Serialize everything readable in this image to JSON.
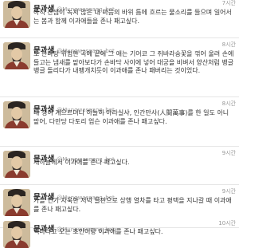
{
  "tweets": [
    {
      "name": "문과생",
      "handle": "@Mungwaseang_bot",
      "time": "7시간",
      "text": "아직 찬샘이 녹지 않은 내 마음의 바위 틈에 흐르는 물소리를 들으며 일어서는 봄과 함께 이과애들을 존나 패고싶다."
    },
    {
      "name": "문과생",
      "handle": "@Mungwaseang_bot",
      "time": "8시간",
      "text": "또 한바탕 위험한 곡예 끝에 그 애는 기어코 그 쥐바라숭꽃을 꺾어 울려 손에 들고는 냄새를 맡아보다가 손바닥 사이에 넣어 대궁을 비벼서 양산처럼 뱅글뱅글 돌리다가 내팽개치듯이 이과애를 존나 패버리는 것이었다."
    },
    {
      "name": "문과생",
      "handle": "@Mungwaseang_bot",
      "time": "8시간",
      "text": "내 생이 계으르더니 하늘히 아라실샤, 인간만사(人間萬事)를 한 일도 아니 맡어, 다만당 다토리 업슨 이과애를 존나 패고싶다."
    },
    {
      "name": "문과생",
      "handle": "@Mungwaseang_bot",
      "time": "9시간",
      "text": "새하늘에서 이과애를 존나 패고싶다."
    },
    {
      "name": "문과생",
      "handle": "@Mungwaseang_bot",
      "time": "9시간",
      "text": "가을 연기 자욱한 저녁 들판으로 상행 열차를 타고 평택을 지나갈 때 이과애를 존나 패고싶다."
    },
    {
      "name": "문과생",
      "handle": "@Mungwaseang_bot",
      "time": "10시간",
      "text": "백마타고 오는 초인이랑 이과애를 존나 패고싶다."
    }
  ]
}
